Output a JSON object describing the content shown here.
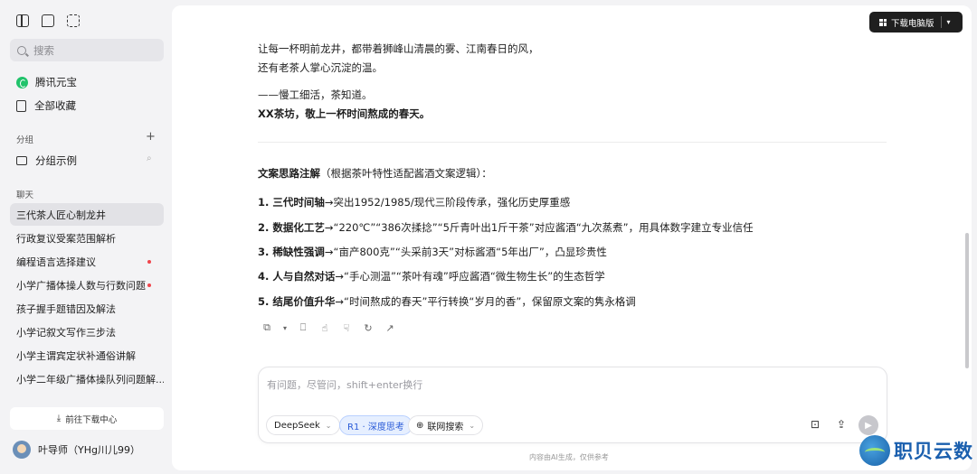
{
  "sidebar": {
    "search_placeholder": "搜索",
    "nav": [
      "腾讯元宝",
      "全部收藏"
    ],
    "group_section": "分组",
    "group_example": "分组示例",
    "chat_section": "聊天",
    "chats": [
      "三代茶人匠心制龙井",
      "行政复议受案范围解析",
      "编程语言选择建议",
      "小学广播体操人数与行数问题",
      "孩子握手题错因及解法",
      "小学记叙文写作三步法",
      "小学主谓宾定状补通俗讲解",
      "小学二年级广播体操队列问题解..."
    ],
    "download_center": "前往下载中心",
    "user_name": "叶导师（YHg川儿99）"
  },
  "header": {
    "download_button": "下载电脑版"
  },
  "message": {
    "l1": "让每一杯明前龙井，都带着狮峰山清晨的雾、江南春日的风，",
    "l2": "还有老茶人掌心沉淀的温。",
    "l3": "——慢工细活，茶知道。",
    "l4": "XX茶坊，敬上一杯时间熬成的春天。",
    "notes_title_bold": "文案思路注解",
    "notes_title_rest": "（根据茶叶特性适配酱酒文案逻辑）：",
    "points": [
      {
        "bold": "1. 三代时间轴",
        "rest": "→突出1952/1985/现代三阶段传承，强化历史厚重感"
      },
      {
        "bold": "2. 数据化工艺",
        "rest": "→“220℃”“386次揉捻”“5斤青叶出1斤干茶”对应酱酒“九次蒸煮”，用具体数字建立专业信任"
      },
      {
        "bold": "3. 稀缺性强调",
        "rest": "→“亩产800克”“头采前3天”对标酱酒“5年出厂”，凸显珍贵性"
      },
      {
        "bold": "4. 人与自然对话",
        "rest": "→“手心测温”“茶叶有魂”呼应酱酒“微生物生长”的生态哲学"
      },
      {
        "bold": "5. 结尾价值升华",
        "rest": "→“时间熬成的春天”平行转换“岁月的香”，保留原文案的隽永格调"
      }
    ]
  },
  "composer": {
    "placeholder": "有问题，尽管问，shift+enter换行",
    "model": "DeepSeek",
    "deep_think": "R1 · 深度思考",
    "web_search": "联网搜索"
  },
  "footer": {
    "disclaimer": "内容由AI生成，仅供参考"
  },
  "watermark": {
    "text": "职贝云数"
  },
  "colors": {
    "accent": "#2a5bd7",
    "unread_dot": "#f0444b",
    "brand_green": "#21c36b"
  }
}
